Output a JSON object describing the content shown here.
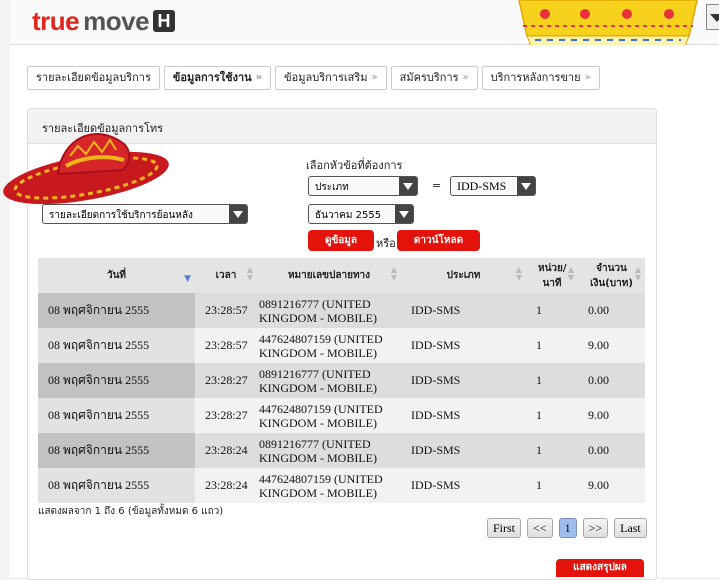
{
  "brand": {
    "logo_part1": "true",
    "logo_part2": "move",
    "logo_badge": "H"
  },
  "tabs": [
    {
      "label": "รายละเอียดข้อมูลบริการ",
      "active": false
    },
    {
      "label": "ข้อมูลการใช้งาน",
      "active": true
    },
    {
      "label": "ข้อมูลบริการเสริม",
      "active": false
    },
    {
      "label": "สมัครบริการ",
      "active": false
    },
    {
      "label": "บริการหลังการขาย",
      "active": false
    }
  ],
  "panel": {
    "title": "รายละเอียดข้อมูลการโทร",
    "left_select_value": "รายละเอียดการใช้บริการย้อนหลัง",
    "topic_label": "เลือกหัวข้อที่ต้องการ",
    "filter_field_value": "ประเภท",
    "equals": "=",
    "filter_value": "IDD-SMS",
    "month_value": "ธันวาคม 2555",
    "view_button": "ดูข้อมูล",
    "or_label": "หรือ",
    "download_button": "ดาวน์โหลด"
  },
  "table": {
    "columns": [
      "วันที่",
      "เวลา",
      "หมายเลขปลายทาง",
      "ประเภท",
      "หน่วย/ นาที",
      "จำนวน เงิน(บาท)"
    ],
    "rows": [
      [
        "08 พฤศจิกายน 2555",
        "23:28:57",
        "0891216777 (UNITED KINGDOM - MOBILE)",
        "IDD-SMS",
        "1",
        "0.00"
      ],
      [
        "08 พฤศจิกายน 2555",
        "23:28:57",
        "447624807159 (UNITED KINGDOM - MOBILE)",
        "IDD-SMS",
        "1",
        "9.00"
      ],
      [
        "08 พฤศจิกายน 2555",
        "23:28:27",
        "0891216777 (UNITED KINGDOM - MOBILE)",
        "IDD-SMS",
        "1",
        "0.00"
      ],
      [
        "08 พฤศจิกายน 2555",
        "23:28:27",
        "447624807159 (UNITED KINGDOM - MOBILE)",
        "IDD-SMS",
        "1",
        "9.00"
      ],
      [
        "08 พฤศจิกายน 2555",
        "23:28:24",
        "0891216777 (UNITED KINGDOM - MOBILE)",
        "IDD-SMS",
        "1",
        "0.00"
      ],
      [
        "08 พฤศจิกายน 2555",
        "23:28:24",
        "447624807159 (UNITED KINGDOM - MOBILE)",
        "IDD-SMS",
        "1",
        "9.00"
      ]
    ],
    "summary": "แสดงผลจาก 1 ถึง 6 (ข้อมูลทั้งหมด 6 แถว)"
  },
  "pager": {
    "first": "First",
    "prev": "<<",
    "current": "1",
    "next": ">>",
    "last": "Last"
  },
  "summary_button": "แสดงสรุปผล",
  "colors": {
    "brand_red": "#e0261d",
    "button_red": "#e3120b",
    "header_gray": "#e4e4e4",
    "active_page": "#9fbdea"
  }
}
